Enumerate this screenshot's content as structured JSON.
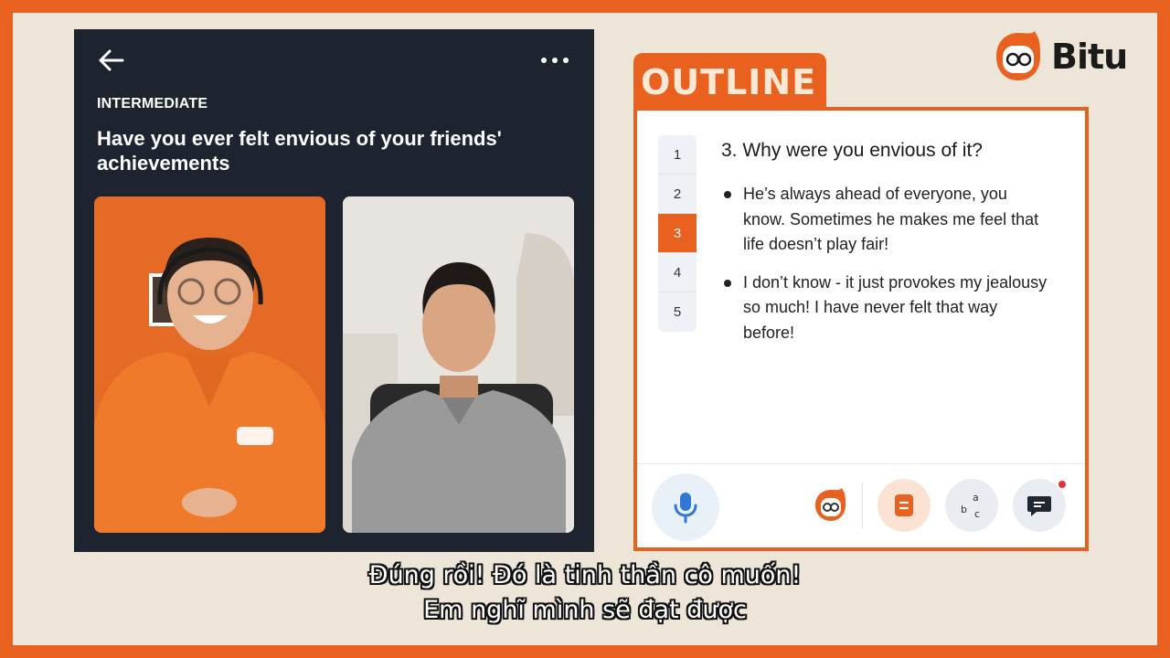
{
  "brand": {
    "name": "Bitu",
    "logo_icon": "owl-logo-icon",
    "accent": "#e8611e"
  },
  "lesson": {
    "level": "INTERMEDIATE",
    "title": "Have you ever felt envious of your friends' achievements"
  },
  "outline": {
    "tab_label": "OUTLINE",
    "steps": [
      "1",
      "2",
      "3",
      "4",
      "5"
    ],
    "active_step": "3",
    "question": "3. Why were you envious of it?",
    "answers": [
      "He’s always ahead of everyone, you know. Sometimes he makes me feel that life doesn’t play fair!",
      "I don’t know - it just provokes my jealousy so much! I have never felt that way before!"
    ]
  },
  "toolbar": {
    "icons": [
      "microphone-icon",
      "bitu-assistant-icon",
      "notes-icon",
      "vocabulary-icon",
      "chat-icon"
    ],
    "chat_has_notification": true
  },
  "subtitles": {
    "line1": "Đúng rồi! Đó là tinh thần cô muốn!",
    "line2": "Em nghĩ mình sẽ đạt được"
  }
}
